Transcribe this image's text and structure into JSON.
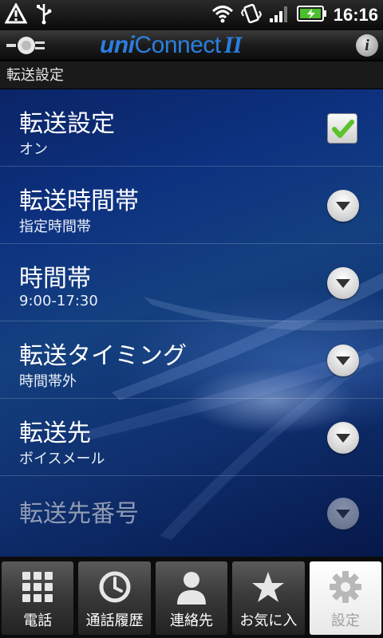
{
  "status_bar": {
    "time": "16:16",
    "icons": [
      "alert-icon",
      "usb-icon",
      "wifi-icon",
      "vibrate-icon",
      "signal-icon",
      "battery-charging-icon"
    ]
  },
  "app": {
    "brand_uni": "uni",
    "brand_connect": "Connect",
    "brand_version": "II",
    "info_label": "i"
  },
  "section": {
    "title": "転送設定"
  },
  "settings": [
    {
      "title": "転送設定",
      "subtitle": "オン",
      "control": "checkbox",
      "checked": true
    },
    {
      "title": "転送時間帯",
      "subtitle": "指定時間帯",
      "control": "dropdown"
    },
    {
      "title": "時間帯",
      "subtitle": "9:00-17:30",
      "control": "dropdown"
    },
    {
      "title": "転送タイミング",
      "subtitle": "時間帯外",
      "control": "dropdown"
    },
    {
      "title": "転送先",
      "subtitle": "ボイスメール",
      "control": "dropdown"
    },
    {
      "title": "転送先番号",
      "subtitle": "",
      "control": "dropdown",
      "enabled": false
    }
  ],
  "tabs": [
    {
      "label": "電話",
      "icon": "dialpad-icon",
      "active": false
    },
    {
      "label": "通話履歴",
      "icon": "clock-icon",
      "active": false
    },
    {
      "label": "連絡先",
      "icon": "person-icon",
      "active": false
    },
    {
      "label": "お気に入",
      "icon": "star-icon",
      "active": false
    },
    {
      "label": "設定",
      "icon": "gear-icon",
      "active": true
    }
  ],
  "colors": {
    "brand": "#2a7fe0",
    "background_blue": "#0d3280",
    "check_green": "#5cc22a"
  }
}
